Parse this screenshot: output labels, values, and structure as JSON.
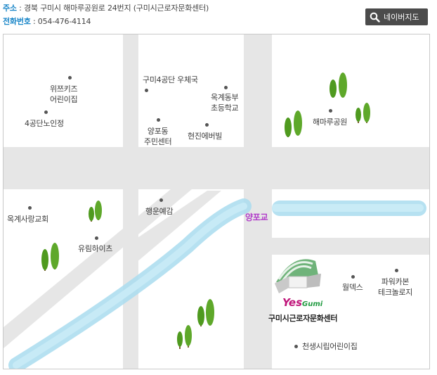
{
  "header": {
    "address_label": "주소",
    "address_text": "경북 구미시 해마루공원로 24번지 (구미시근로자문화센터)",
    "phone_label": "전화번호",
    "phone_text": "054-476-4114",
    "separator": ":"
  },
  "map_button": {
    "label": "네이버지도",
    "icon": "search-icon"
  },
  "map": {
    "places": {
      "wizkids": "위쯔키즈\n어린이집",
      "senior": "4공단노인정",
      "post": "구미4공단 우체국",
      "okgye_school": "옥계동부\n초등학교",
      "yangpo_center": "양포동\n주민센터",
      "hyunjin": "현진에버빌",
      "haemaru": "해마루공원",
      "haengun": "행운예감",
      "sarang": "옥계사랑교회",
      "yurim": "유림하이츠",
      "bridge": "양포교",
      "welldex": "월덱스",
      "powercarbon": "파워카본\n테크놀로지",
      "cheonsaeng": "천생시립어린이집",
      "culture_center": "구미시근로자문화센터",
      "logo_yes": "Yes",
      "logo_gumi": "Gumi"
    },
    "colors": {
      "road": "#e6e6e6",
      "river": "#a9dcef",
      "tree": "#4f9a1f",
      "bridge_label": "#b13cc9",
      "accent": "#1a86c8"
    }
  }
}
